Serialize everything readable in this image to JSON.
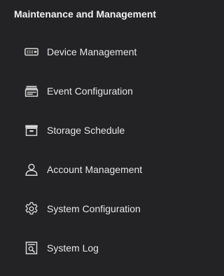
{
  "section": {
    "title": "Maintenance and Management"
  },
  "menu": {
    "items": [
      {
        "label": "Device Management",
        "icon": "device-management-icon"
      },
      {
        "label": "Event Configuration",
        "icon": "event-configuration-icon"
      },
      {
        "label": "Storage Schedule",
        "icon": "storage-schedule-icon"
      },
      {
        "label": "Account Management",
        "icon": "account-management-icon"
      },
      {
        "label": "System Configuration",
        "icon": "system-configuration-icon"
      },
      {
        "label": "System Log",
        "icon": "system-log-icon"
      }
    ]
  },
  "colors": {
    "background": "#232325",
    "text": "#e6e6e6",
    "title": "#f2f2f2",
    "icon": "#d8d8d8"
  }
}
